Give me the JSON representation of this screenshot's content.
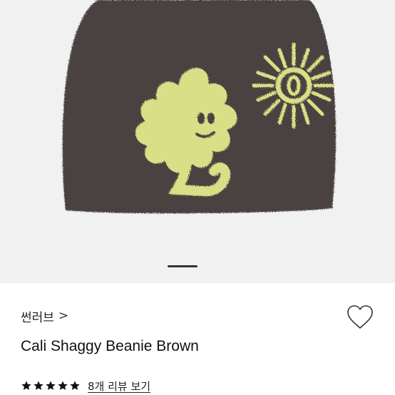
{
  "product": {
    "brand": "썬러브",
    "brand_chevron": ">",
    "title": "Cali Shaggy Beanie Brown",
    "rating": 5,
    "rating_max": 5,
    "review_link": "8개 리뷰 보기",
    "wishlist_icon": "heart-outline-icon",
    "gallery_icon": "product-image-beanie"
  },
  "carousel": {
    "slide_indicator": "active"
  },
  "colors": {
    "hero_background": "#f1f1f1",
    "beanie_brown": "#4a4340",
    "graphic_yellow": "#d9df86",
    "text": "#111111",
    "star": "#111111"
  }
}
